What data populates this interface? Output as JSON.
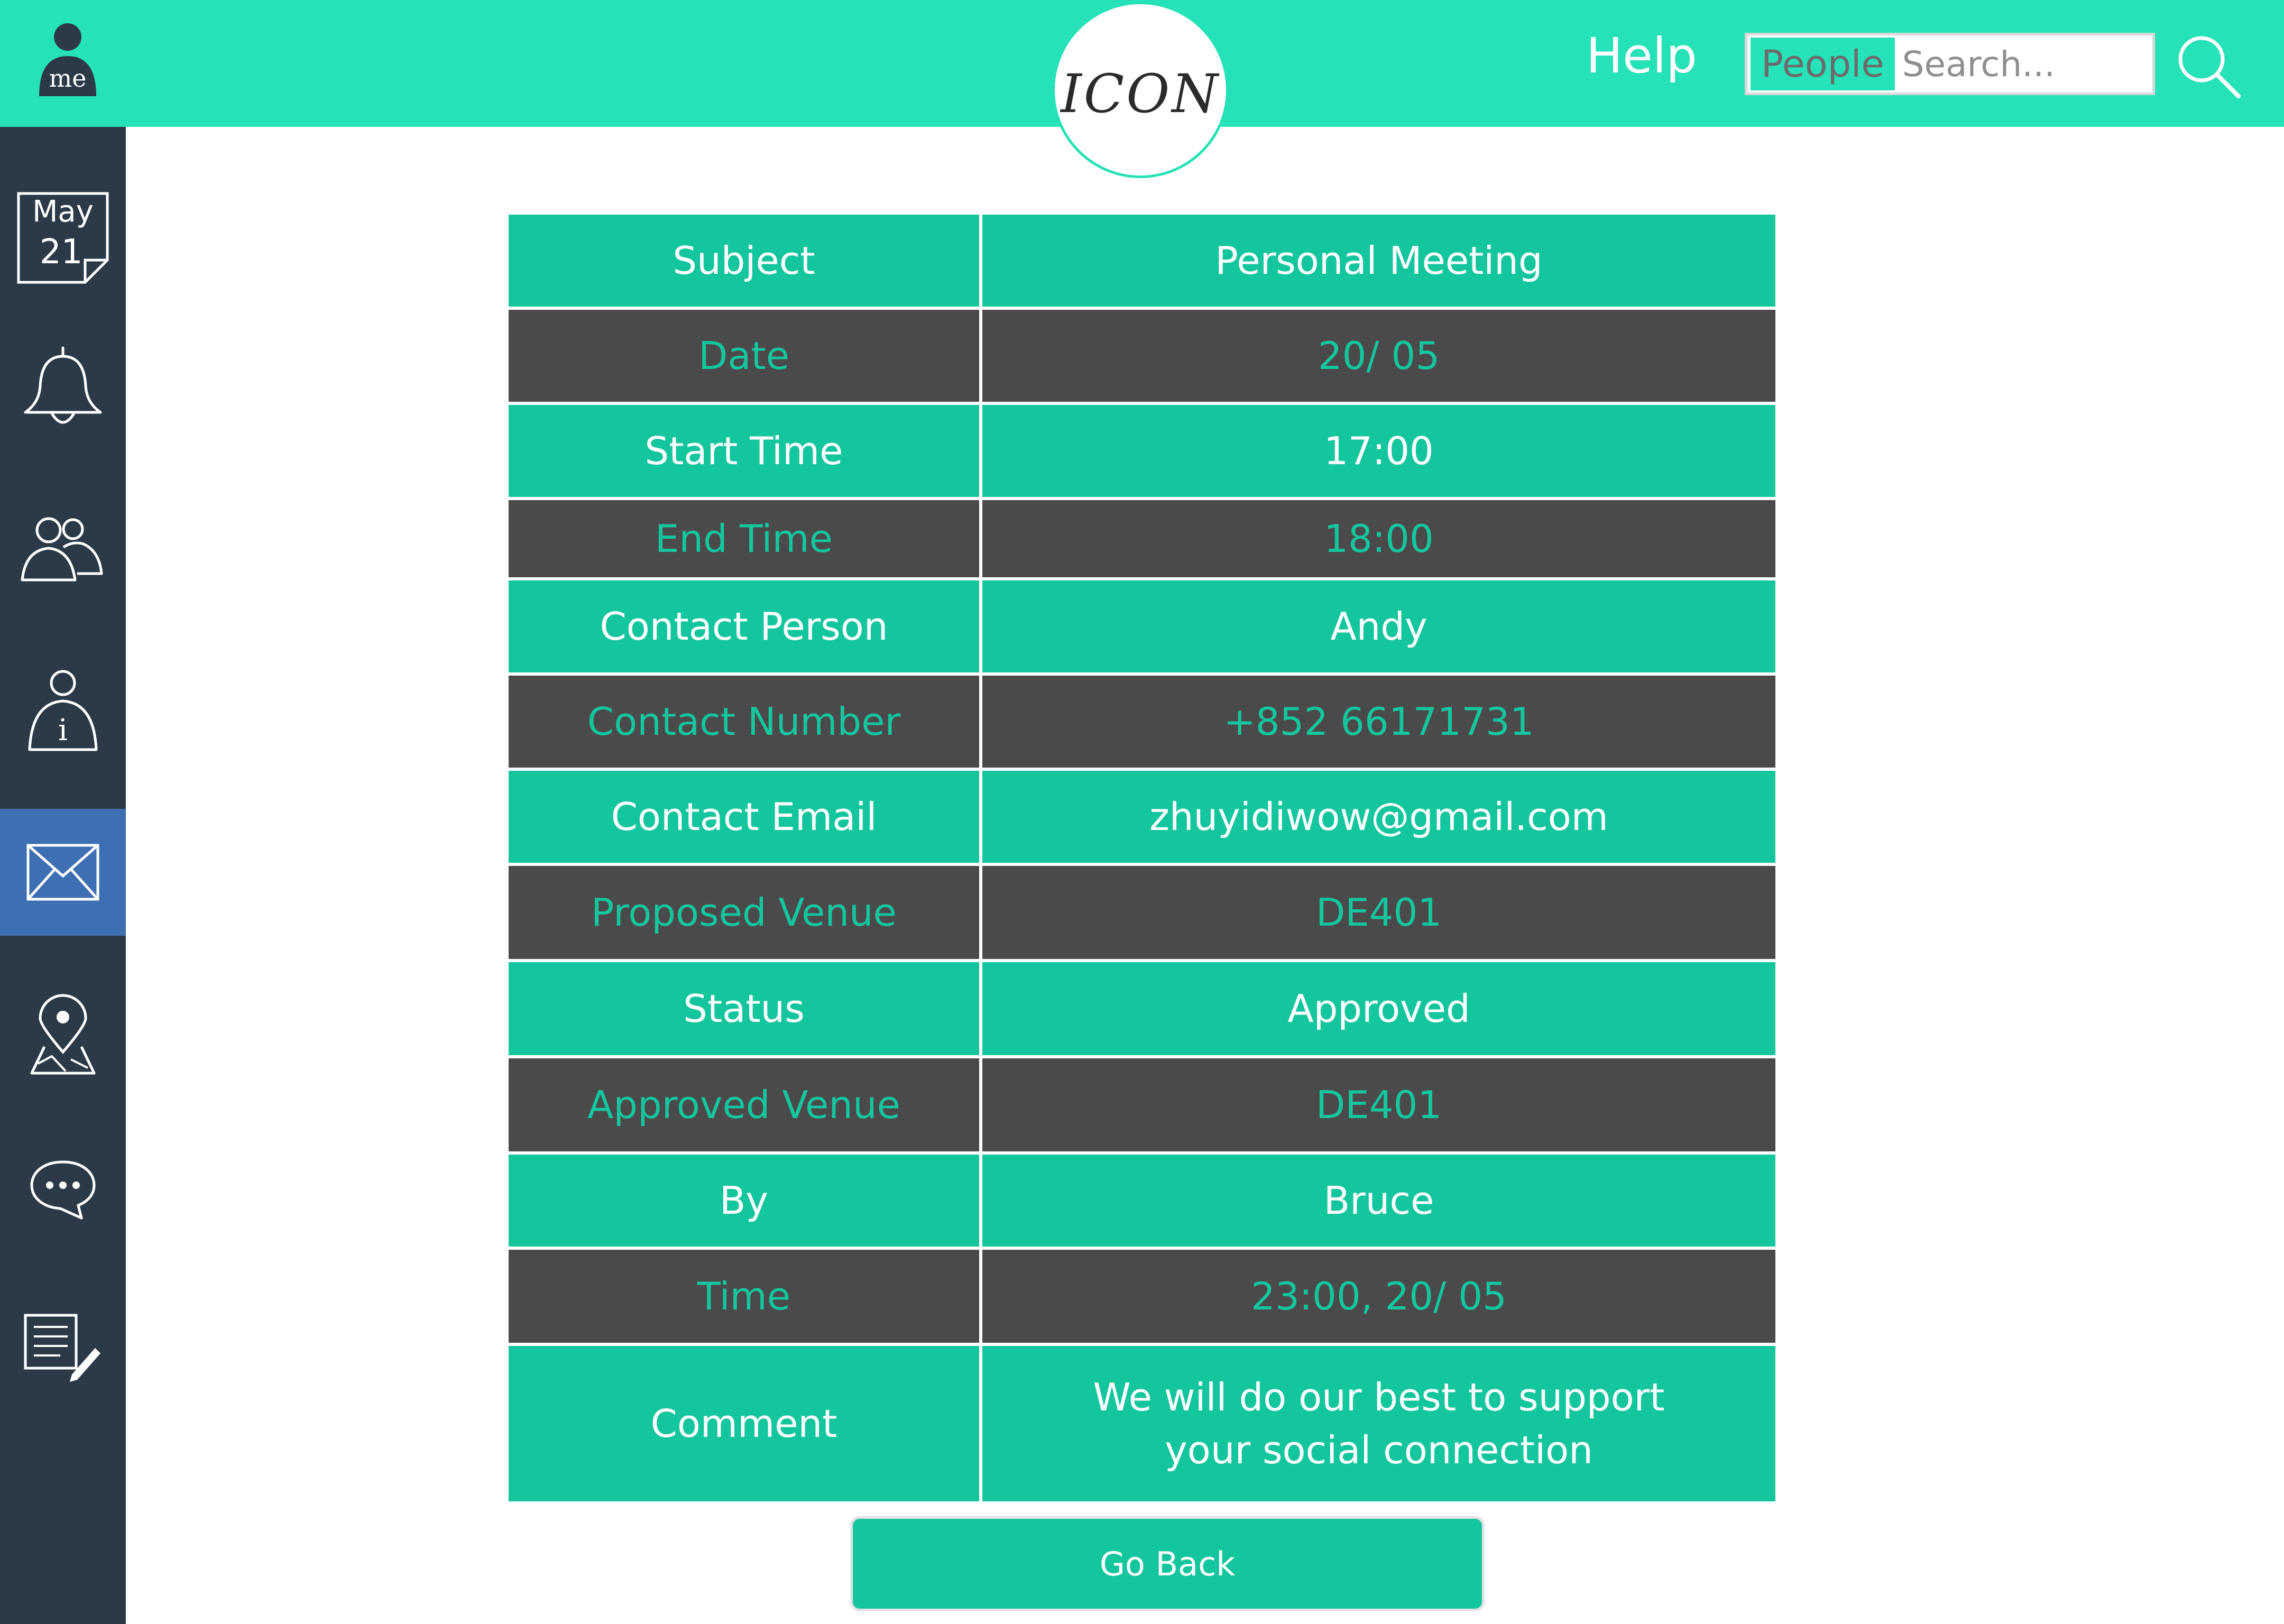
{
  "header": {
    "avatar_label": "me",
    "logo_text": "ICON",
    "help_label": "Help",
    "search": {
      "scope": "People",
      "placeholder": "Search..."
    },
    "brand_color": "#26e2b8"
  },
  "sidebar": {
    "calendar": {
      "month": "May",
      "day": "21"
    },
    "items": [
      {
        "icon": "calendar-icon"
      },
      {
        "icon": "bell-icon"
      },
      {
        "icon": "people-icon"
      },
      {
        "icon": "person-info-icon"
      },
      {
        "icon": "mail-icon",
        "active": true
      },
      {
        "icon": "map-pin-icon"
      },
      {
        "icon": "chat-icon"
      },
      {
        "icon": "notes-edit-icon"
      }
    ],
    "active_color": "#3d6fb2",
    "background_color": "#2c3a47"
  },
  "details": {
    "rows": [
      {
        "label": "Subject",
        "value": "Personal Meeting"
      },
      {
        "label": "Date",
        "value": "20/ 05"
      },
      {
        "label": "Start Time",
        "value": "17:00"
      },
      {
        "label": "End Time",
        "value": "18:00"
      },
      {
        "label": "Contact Person",
        "value": "Andy"
      },
      {
        "label": "Contact Number",
        "value": "+852 66171731"
      },
      {
        "label": "Contact Email",
        "value": "zhuyidiwow@gmail.com"
      },
      {
        "label": "Proposed Venue",
        "value": "DE401"
      },
      {
        "label": "Status",
        "value": "Approved"
      },
      {
        "label": "Approved Venue",
        "value": "DE401"
      },
      {
        "label": "By",
        "value": "Bruce"
      },
      {
        "label": "Time",
        "value": "23:00, 20/ 05"
      },
      {
        "label": "Comment",
        "value": "We will do our best to support your social connection"
      }
    ],
    "teal_color": "#14c69e",
    "dark_color": "#4a4a4a"
  },
  "actions": {
    "go_back_label": "Go Back"
  }
}
